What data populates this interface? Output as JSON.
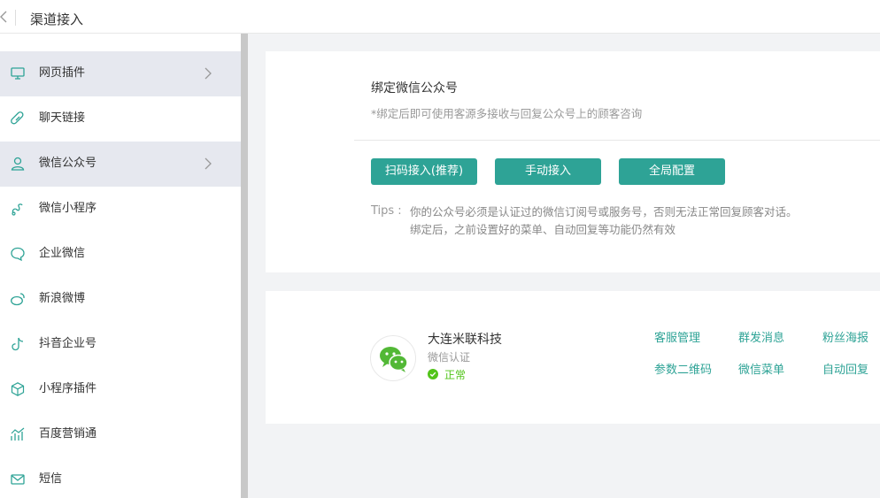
{
  "header": {
    "title": "渠道接入"
  },
  "sidebar": {
    "items": [
      {
        "label": "网页插件",
        "icon": "monitor-icon",
        "active": true,
        "has_chevron": true
      },
      {
        "label": "聊天链接",
        "icon": "link-icon",
        "active": false,
        "has_chevron": false
      },
      {
        "label": "微信公众号",
        "icon": "user-icon",
        "active": true,
        "has_chevron": true
      },
      {
        "label": "微信小程序",
        "icon": "miniprogram-icon",
        "active": false,
        "has_chevron": false
      },
      {
        "label": "企业微信",
        "icon": "chat-bubble-icon",
        "active": false,
        "has_chevron": false
      },
      {
        "label": "新浪微博",
        "icon": "weibo-icon",
        "active": false,
        "has_chevron": false
      },
      {
        "label": "抖音企业号",
        "icon": "douyin-icon",
        "active": false,
        "has_chevron": false
      },
      {
        "label": "小程序插件",
        "icon": "cube-icon",
        "active": false,
        "has_chevron": false
      },
      {
        "label": "百度营销通",
        "icon": "chart-trend-icon",
        "active": false,
        "has_chevron": false
      },
      {
        "label": "短信",
        "icon": "mail-icon",
        "active": false,
        "has_chevron": false
      }
    ]
  },
  "bind_card": {
    "heading": "绑定微信公众号",
    "subheading": "*绑定后即可使用客源多接收与回复公众号上的顾客咨询",
    "buttons": {
      "scan": "扫码接入(推荐)",
      "manual": "手动接入",
      "global": "全局配置"
    },
    "tips_label": "Tips :",
    "tips_line1": "你的公众号必须是认证过的微信订阅号或服务号，否则无法正常回复顾客对话。",
    "tips_line2": "绑定后，之前设置好的菜单、自动回复等功能仍然有效"
  },
  "account_card": {
    "name": "大连米联科技",
    "type": "微信认证",
    "status": "正常",
    "links": {
      "service": "客服管理",
      "broadcast": "群发消息",
      "fans_poster": "粉丝海报",
      "qrcode": "参数二维码",
      "menu": "微信菜单",
      "auto_reply": "自动回复"
    }
  },
  "colors": {
    "accent": "#2ea396",
    "status_ok": "#52c41a",
    "active_bg": "#e6e8ef",
    "icon_teal": "#2ea396"
  }
}
